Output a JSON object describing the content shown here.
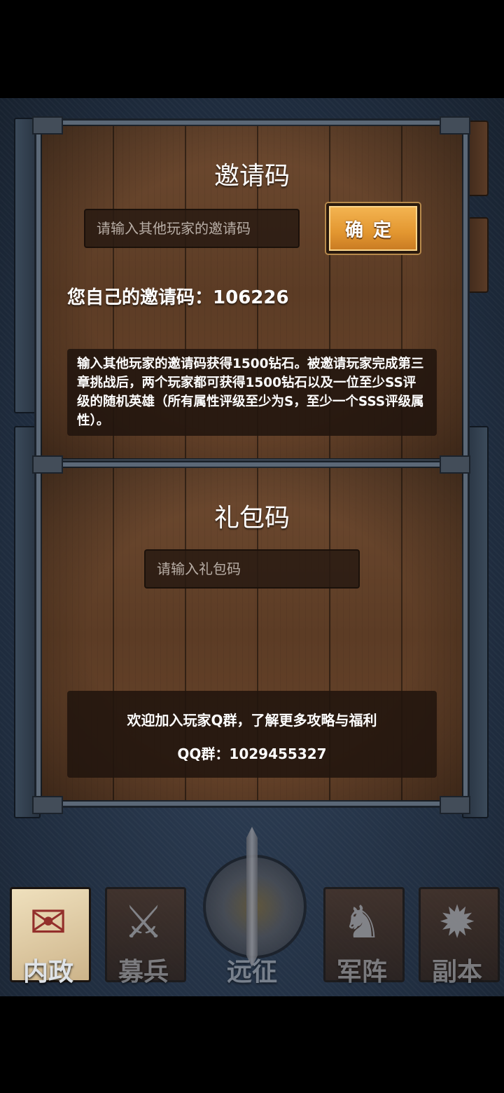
{
  "invite": {
    "title": "邀请码",
    "input_placeholder": "请输入其他玩家的邀请码",
    "confirm_label": "确定",
    "own_code_label": "您自己的邀请码：",
    "own_code_value": "106226",
    "description": "输入其他玩家的邀请码获得1500钻石。被邀请玩家完成第三章挑战后，两个玩家都可获得1500钻石以及一位至少SS评级的随机英雄（所有属性评级至少为S，至少一个SSS评级属性）。"
  },
  "gift": {
    "title": "礼包码",
    "input_placeholder": "请输入礼包码",
    "qq_invite_text": "欢迎加入玩家Q群，了解更多攻略与福利",
    "qq_group_label": "QQ群：",
    "qq_group_number": "1029455327"
  },
  "bottom_nav": [
    {
      "label": "内政",
      "icon": "scroll-seal-icon",
      "active": true
    },
    {
      "label": "募兵",
      "icon": "soldiers-icon",
      "active": false
    },
    {
      "label": "远征",
      "icon": "sword-emblem-icon",
      "active": false
    },
    {
      "label": "军阵",
      "icon": "chess-knight-icon",
      "active": false
    },
    {
      "label": "副本",
      "icon": "flame-icon",
      "active": false
    }
  ]
}
